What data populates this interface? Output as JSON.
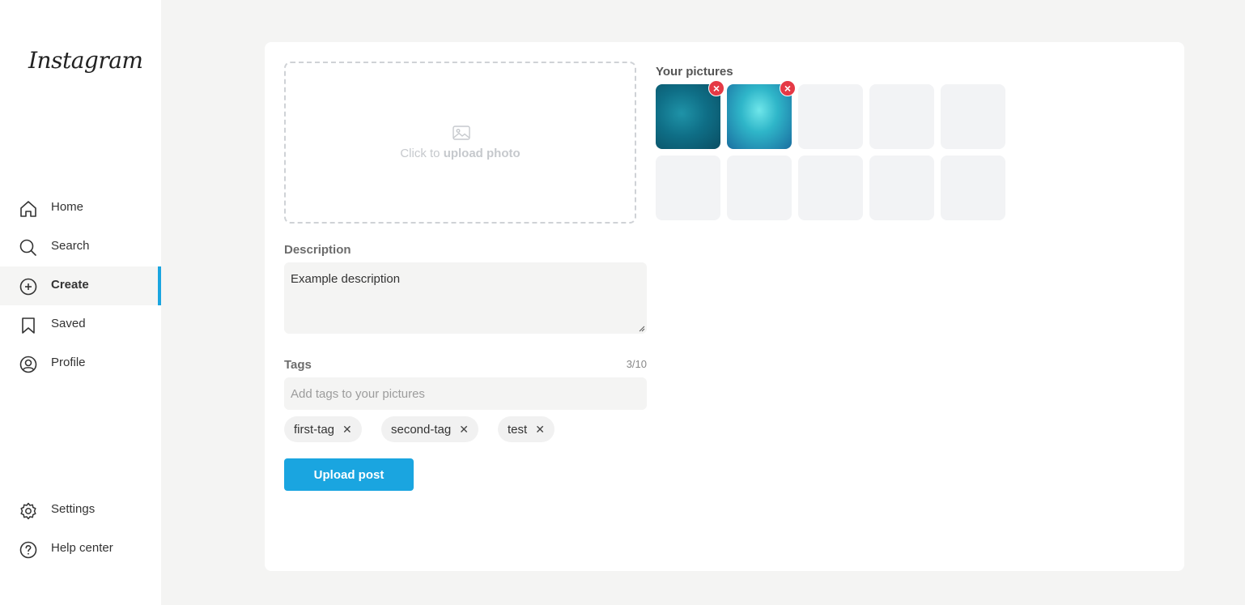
{
  "app": {
    "logo": "Instagram"
  },
  "sidebar": {
    "items": [
      {
        "label": "Home",
        "icon": "home-icon"
      },
      {
        "label": "Search",
        "icon": "search-icon"
      },
      {
        "label": "Create",
        "icon": "plus-circle-icon",
        "active": true
      },
      {
        "label": "Saved",
        "icon": "bookmark-icon"
      },
      {
        "label": "Profile",
        "icon": "user-circle-icon"
      }
    ],
    "bottom_items": [
      {
        "label": "Settings",
        "icon": "gear-icon"
      },
      {
        "label": "Help center",
        "icon": "help-icon"
      }
    ]
  },
  "upload": {
    "prefix": "Click to",
    "action": "upload photo",
    "icon": "image-icon"
  },
  "description": {
    "label": "Description",
    "value": "Example description"
  },
  "tags": {
    "label": "Tags",
    "count": "3/10",
    "placeholder": "Add tags to your pictures",
    "items": [
      "first-tag",
      "second-tag",
      "test"
    ]
  },
  "actions": {
    "upload_label": "Upload post"
  },
  "pictures": {
    "label": "Your pictures",
    "filled": 2,
    "total": 10,
    "remove_icon": "close-circle-icon"
  },
  "colors": {
    "accent": "#1aa5e0",
    "remove": "#e53945",
    "background": "#f4f4f3"
  }
}
